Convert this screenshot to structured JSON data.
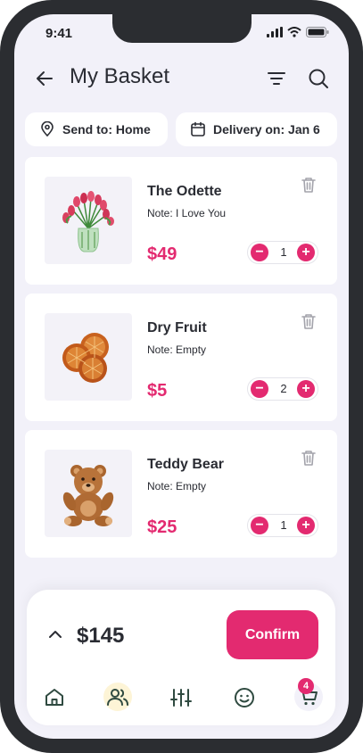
{
  "status_bar": {
    "time": "9:41"
  },
  "header": {
    "title": "My Basket"
  },
  "chips": {
    "send_to": "Send to: Home",
    "delivery": "Delivery on: Jan 6"
  },
  "items": [
    {
      "name": "The Odette",
      "note": "Note: I Love You",
      "price": "$49",
      "quantity": "1",
      "icon": "flower-vase-image"
    },
    {
      "name": "Dry Fruit",
      "note": "Note: Empty",
      "price": "$5",
      "quantity": "2",
      "icon": "dried-orange-image"
    },
    {
      "name": "Teddy Bear",
      "note": "Note: Empty",
      "price": "$25",
      "quantity": "1",
      "icon": "teddy-bear-image"
    }
  ],
  "summary": {
    "total": "$145",
    "confirm_label": "Confirm"
  },
  "bottom_nav": {
    "items": [
      "home-icon",
      "users-icon",
      "sliders-icon",
      "smiley-icon",
      "cart-icon"
    ],
    "cart_badge": "4"
  },
  "colors": {
    "accent": "#e32a70",
    "background": "#f2f1f9",
    "users_highlight": "#fdf4d6"
  }
}
